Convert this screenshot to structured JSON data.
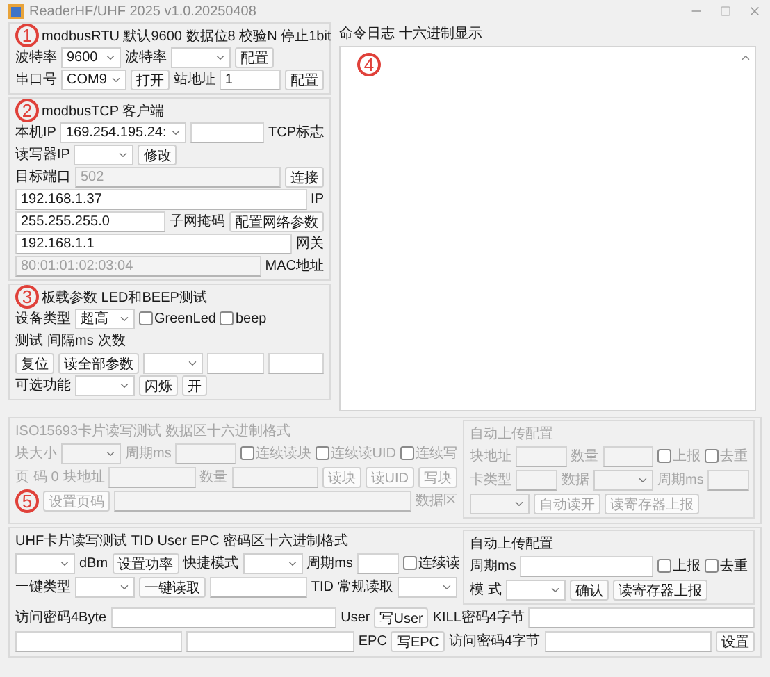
{
  "titlebar": {
    "title": "ReaderHF/UHF 2025 v1.0.20250408"
  },
  "left_groups": [
    {
      "title": "modbusRTU 默认9600 数据位8 校验N 停止1bit",
      "annotation": "1",
      "rows": [
        {
          "items": [
            {
              "kind": "label",
              "text": "波特率"
            },
            {
              "kind": "combo",
              "value": "9600"
            },
            {
              "kind": "label",
              "text": "波特率"
            },
            {
              "kind": "combo"
            },
            {
              "kind": "button",
              "text": "配置"
            }
          ]
        },
        {
          "items": [
            {
              "kind": "label",
              "text": "串口号"
            },
            {
              "kind": "combo",
              "value": "COM9"
            },
            {
              "kind": "button",
              "text": "打开"
            },
            {
              "kind": "label",
              "text": "站地址"
            },
            {
              "kind": "input",
              "value": "1"
            },
            {
              "kind": "button",
              "text": "配置"
            }
          ]
        }
      ]
    },
    {
      "title": "modbusTCP 客户端",
      "annotation": "2",
      "rows": [
        {
          "items": [
            {
              "kind": "label",
              "text": "本机IP"
            },
            {
              "kind": "combo",
              "value": "169.254.195.24:"
            },
            {
              "kind": "input"
            },
            {
              "kind": "label",
              "text": "TCP标志"
            }
          ]
        },
        {
          "items": [
            {
              "kind": "label",
              "text": "读写器IP"
            },
            {
              "kind": "combo"
            },
            {
              "kind": "button",
              "text": "修改"
            }
          ]
        },
        {
          "items": [
            {
              "kind": "label",
              "text": "目标端口"
            },
            {
              "kind": "input",
              "value": "502",
              "disabled": true
            },
            {
              "kind": "button",
              "text": "连接"
            }
          ]
        },
        {
          "items": [
            {
              "kind": "input",
              "value": "192.168.1.37"
            },
            {
              "kind": "label",
              "text": "IP"
            }
          ]
        },
        {
          "items": [
            {
              "kind": "input",
              "value": "255.255.255.0"
            },
            {
              "kind": "label",
              "text": "子网掩码"
            },
            {
              "kind": "button",
              "text": "配置网络参数"
            }
          ]
        },
        {
          "items": [
            {
              "kind": "input",
              "value": "192.168.1.1"
            },
            {
              "kind": "label",
              "text": "网关"
            }
          ]
        },
        {
          "items": [
            {
              "kind": "input",
              "value": "80:01:01:02:03:04",
              "disabled": true
            },
            {
              "kind": "label",
              "text": "MAC地址"
            }
          ]
        }
      ]
    },
    {
      "title": "板载参数 LED和BEEP测试",
      "annotation": "3",
      "rows": [
        {
          "items": [
            {
              "kind": "label",
              "text": "设备类型"
            },
            {
              "kind": "combo",
              "value": "超高"
            },
            {
              "kind": "checkbox",
              "text": "GreenLed",
              "checked": false
            },
            {
              "kind": "checkbox",
              "text": "beep",
              "checked": false
            }
          ]
        },
        {
          "items": [
            {
              "kind": "label",
              "text": "测试"
            },
            {
              "kind": "label",
              "text": "间隔ms"
            },
            {
              "kind": "label",
              "text": "次数"
            }
          ]
        },
        {
          "items": [
            {
              "kind": "button",
              "text": "复位"
            },
            {
              "kind": "button",
              "text": "读全部参数"
            },
            {
              "kind": "combo"
            },
            {
              "kind": "input"
            },
            {
              "kind": "input"
            }
          ]
        },
        {
          "items": [
            {
              "kind": "label",
              "text": "可选功能"
            },
            {
              "kind": "combo"
            },
            {
              "kind": "button",
              "text": "闪烁"
            },
            {
              "kind": "button",
              "text": "开"
            }
          ]
        }
      ]
    }
  ],
  "log": {
    "title": "命令日志 十六进制显示",
    "annotation": "4"
  },
  "bottom_groups": [
    {
      "title": "ISO15693卡片读写测试 数据区十六进制格式",
      "disabled": true,
      "rows": [
        {
          "items": [
            {
              "kind": "label",
              "text": "块大小"
            },
            {
              "kind": "combo"
            },
            {
              "kind": "label",
              "text": "周期ms"
            },
            {
              "kind": "input"
            },
            {
              "kind": "checkbox",
              "text": "连续读块",
              "checked": false
            },
            {
              "kind": "checkbox",
              "text": "连续读UID",
              "checked": false
            },
            {
              "kind": "checkbox",
              "text": "连续写",
              "checked": false
            }
          ]
        },
        {
          "items": [
            {
              "kind": "label",
              "text": "页 码"
            },
            {
              "kind": "label",
              "text": "0"
            },
            {
              "kind": "label",
              "text": "块地址"
            },
            {
              "kind": "input"
            },
            {
              "kind": "label",
              "text": "数量"
            },
            {
              "kind": "input"
            },
            {
              "kind": "button",
              "text": "读块"
            },
            {
              "kind": "button",
              "text": "读UID"
            },
            {
              "kind": "button",
              "text": "写块"
            }
          ]
        },
        {
          "items": [
            {
              "kind": "annotation",
              "text": "5"
            },
            {
              "kind": "button",
              "text": "设置页码"
            },
            {
              "kind": "input"
            },
            {
              "kind": "label",
              "text": "数据区"
            }
          ]
        }
      ],
      "side": {
        "title": "自动上传配置",
        "rows": [
          {
            "items": [
              {
                "kind": "label",
                "text": "块地址"
              },
              {
                "kind": "input"
              },
              {
                "kind": "label",
                "text": "数量"
              },
              {
                "kind": "input"
              },
              {
                "kind": "checkbox",
                "text": "上报",
                "checked": false
              },
              {
                "kind": "checkbox",
                "text": "去重",
                "checked": false
              }
            ]
          },
          {
            "items": [
              {
                "kind": "label",
                "text": "卡类型"
              },
              {
                "kind": "input"
              },
              {
                "kind": "label",
                "text": "数据"
              },
              {
                "kind": "combo"
              },
              {
                "kind": "label",
                "text": "周期ms"
              },
              {
                "kind": "input"
              }
            ]
          },
          {
            "items": [
              {
                "kind": "combo"
              },
              {
                "kind": "button",
                "text": "自动读开"
              },
              {
                "kind": "button",
                "text": "读寄存器上报"
              }
            ]
          }
        ]
      }
    },
    {
      "title": "UHF卡片读写测试  TID User EPC 密码区十六进制格式",
      "disabled": false,
      "rows": [
        {
          "items": [
            {
              "kind": "combo"
            },
            {
              "kind": "label",
              "text": "dBm"
            },
            {
              "kind": "button",
              "text": "设置功率"
            },
            {
              "kind": "label",
              "text": "快捷模式"
            },
            {
              "kind": "combo"
            },
            {
              "kind": "label",
              "text": "周期ms"
            },
            {
              "kind": "input"
            },
            {
              "kind": "checkbox",
              "text": "连续读",
              "checked": false
            }
          ]
        },
        {
          "items": [
            {
              "kind": "label",
              "text": "一键类型"
            },
            {
              "kind": "combo"
            },
            {
              "kind": "button",
              "text": "一键读取"
            },
            {
              "kind": "input"
            },
            {
              "kind": "label",
              "text": "TID"
            },
            {
              "kind": "label",
              "text": "常规读取"
            },
            {
              "kind": "combo"
            }
          ]
        }
      ],
      "side": {
        "title": "自动上传配置",
        "rows": [
          {
            "items": [
              {
                "kind": "label",
                "text": "周期ms"
              },
              {
                "kind": "input"
              },
              {
                "kind": "checkbox",
                "text": "上报",
                "checked": false
              },
              {
                "kind": "checkbox",
                "text": "去重",
                "checked": false
              }
            ]
          },
          {
            "items": [
              {
                "kind": "label",
                "text": "模 式"
              },
              {
                "kind": "combo"
              },
              {
                "kind": "button",
                "text": "确认"
              },
              {
                "kind": "button",
                "text": "读寄存器上报"
              }
            ]
          }
        ]
      },
      "footer_rows": [
        {
          "items": [
            {
              "kind": "label",
              "text": "访问密码4Byte"
            },
            {
              "kind": "input"
            },
            {
              "kind": "label",
              "text": "User"
            },
            {
              "kind": "button",
              "text": "写User"
            },
            {
              "kind": "label",
              "text": "KILL密码4字节"
            },
            {
              "kind": "input"
            }
          ]
        },
        {
          "items": [
            {
              "kind": "input"
            },
            {
              "kind": "input"
            },
            {
              "kind": "label",
              "text": "EPC"
            },
            {
              "kind": "button",
              "text": "写EPC"
            },
            {
              "kind": "label",
              "text": "访问密码4字节"
            },
            {
              "kind": "input"
            },
            {
              "kind": "button",
              "text": "设置"
            }
          ]
        }
      ]
    }
  ]
}
